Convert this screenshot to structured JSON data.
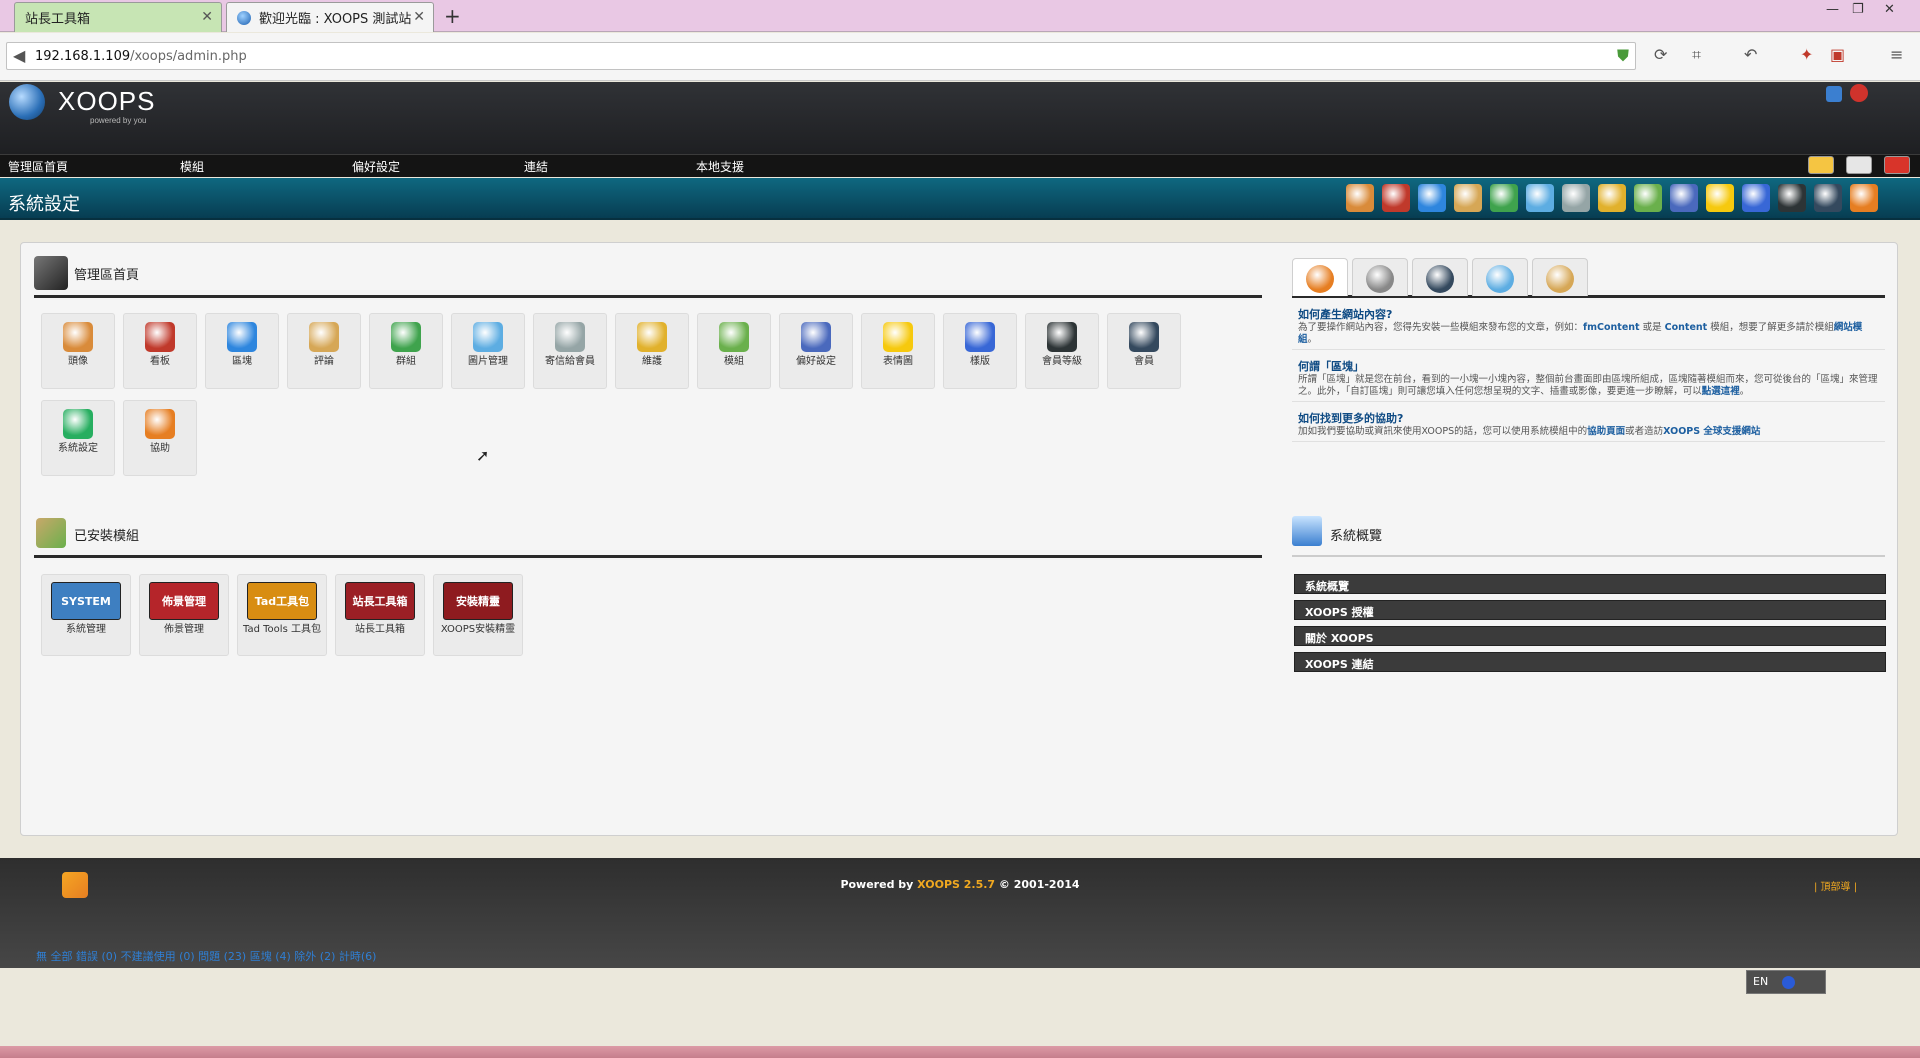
{
  "browser": {
    "tabs": [
      {
        "title": "站長工具箱",
        "active": false
      },
      {
        "title": "歡迎光臨 : XOOPS 測試站",
        "active": true
      }
    ],
    "new_tab": "+",
    "close": "✕",
    "url_host": "192.168.1.109",
    "url_path": "/xoops/admin.php"
  },
  "header": {
    "logo_text": "XOOPS",
    "logo_tagline": "powered by you",
    "menu": [
      "管理區首頁",
      "模組",
      "偏好設定",
      "連結",
      "本地支援"
    ],
    "page_title": "系統設定",
    "toolbar_icons": [
      "avatars-icon",
      "banners-icon",
      "blocks-icon",
      "comments-icon",
      "groups-icon",
      "images-icon",
      "mailusers-icon",
      "maintenance-icon",
      "modules-icon",
      "preferences-icon",
      "smilies-icon",
      "tplsets-icon",
      "userrank-icon",
      "users-icon",
      "help-icon"
    ]
  },
  "admin_home": {
    "title": "管理區首頁",
    "items": [
      {
        "label": "頭像",
        "icon": "avatar-icon",
        "color": "#d98b3a"
      },
      {
        "label": "看板",
        "icon": "banner-icon",
        "color": "#c0392b"
      },
      {
        "label": "區塊",
        "icon": "blocks-icon",
        "color": "#2e86de"
      },
      {
        "label": "評論",
        "icon": "comments-icon",
        "color": "#d6a756"
      },
      {
        "label": "群組",
        "icon": "groups-icon",
        "color": "#3fa34d"
      },
      {
        "label": "圖片管理",
        "icon": "images-icon",
        "color": "#5dade2"
      },
      {
        "label": "寄信給會員",
        "icon": "mail-icon",
        "color": "#95a5a6"
      },
      {
        "label": "維護",
        "icon": "broom-icon",
        "color": "#e1b12c"
      },
      {
        "label": "模組",
        "icon": "modules-icon",
        "color": "#6ab04c"
      },
      {
        "label": "偏好設定",
        "icon": "preferences-icon",
        "color": "#4a69bd"
      },
      {
        "label": "表情圖",
        "icon": "smiley-icon",
        "color": "#f6c90e"
      },
      {
        "label": "樣版",
        "icon": "templates-icon",
        "color": "#3867d6"
      },
      {
        "label": "會員等級",
        "icon": "star-icon",
        "color": "#2d3436"
      },
      {
        "label": "會員",
        "icon": "user-icon",
        "color": "#34495e"
      },
      {
        "label": "系統設定",
        "icon": "system-settings-icon",
        "color": "#27ae60"
      },
      {
        "label": "協助",
        "icon": "help-icon",
        "color": "#e67e22"
      }
    ]
  },
  "installed_modules": {
    "title": "已安裝模組",
    "items": [
      {
        "label": "系統管理",
        "banner": "SYSTEM",
        "color": "#3e7fc1"
      },
      {
        "label": "佈景管理",
        "banner": "佈景管理",
        "color": "#b5252a"
      },
      {
        "label": "Tad Tools 工具包",
        "banner": "Tad工具包",
        "color": "#d88d12"
      },
      {
        "label": "站長工具箱",
        "banner": "站長工具箱",
        "color": "#9b1f25"
      },
      {
        "label": "XOOPS安裝精靈",
        "banner": "安裝精靈",
        "color": "#8e1b1f"
      }
    ]
  },
  "help_tabs": [
    "help-cursor-icon",
    "search-icon",
    "user-icon",
    "community-icon",
    "notes-icon"
  ],
  "faq": [
    {
      "q": "如何產生網站內容?",
      "a": "為了要操作網站內容，您得先安裝一些模組來發布您的文章，例如：",
      "link1": "fmContent",
      "mid": " 或是 ",
      "link2": "Content",
      "tail": " 模組，想要了解更多請於模組",
      "link3": "網站模組",
      "end": "。"
    },
    {
      "q": "何謂「區塊」",
      "a": "所謂「區塊」就是您在前台，看到的一小塊一小塊內容，整個前台畫面即由區塊所組成，區塊隨著模組而來，您可從後台的「區塊」來管理之。此外，「自訂區塊」則可讓您填入任何您想呈現的文字、插畫或影像，要更進一步瞭解，可以",
      "link1": "點選這裡",
      "end": "。"
    },
    {
      "q": "如何找到更多的協助?",
      "a": "加如我們要協助或資訊來使用XOOPS的話，您可以使用系統模組中的",
      "link1": "協助頁面",
      "mid": "或者造訪",
      "link2": "XOOPS 全球支援網站"
    }
  ],
  "overview": {
    "title": "系統概覽",
    "bars": [
      "系統概覽",
      "XOOPS 授權",
      "關於 XOOPS",
      "XOOPS 連結"
    ]
  },
  "footer": {
    "powered": "Powered by ",
    "version": "XOOPS 2.5.7",
    "copyright": " © 2001-2014",
    "right_link": "| 頂部導 |",
    "status": "無 全部 錯誤 (0) 不建議使用 (0) 問題 (23) 區塊 (4) 除外 (2) 計時(6)",
    "lang": "EN"
  },
  "colors": {
    "accent_title_bar": "#0f6880",
    "link": "#0f4b84",
    "version": "#f0a820"
  }
}
